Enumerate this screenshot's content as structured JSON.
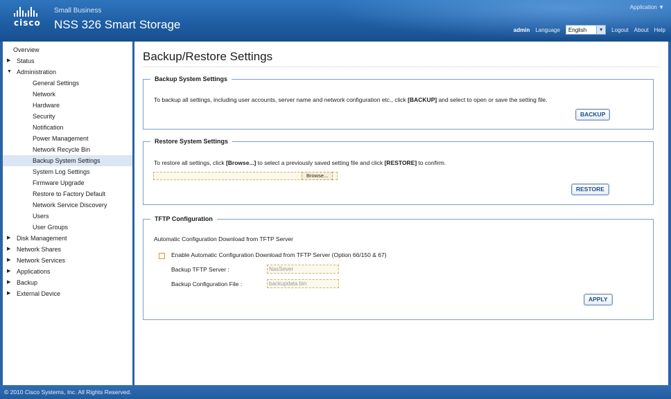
{
  "header": {
    "brand": "cisco",
    "small_business": "Small Business",
    "product": "NSS 326 Smart Storage",
    "application_menu": "Application ▼",
    "user": "admin",
    "language_label": "Language",
    "language_value": "English",
    "logout": "Logout",
    "about": "About",
    "help": "Help"
  },
  "sidebar": {
    "items": [
      {
        "label": "Overview",
        "level": "top",
        "icon": "none"
      },
      {
        "label": "Status",
        "level": "top",
        "icon": "triangle-right-icon"
      },
      {
        "label": "Administration",
        "level": "top",
        "icon": "triangle-down-icon"
      },
      {
        "label": "General Settings",
        "level": "sub",
        "icon": "none"
      },
      {
        "label": "Network",
        "level": "sub",
        "icon": "none"
      },
      {
        "label": "Hardware",
        "level": "sub",
        "icon": "none"
      },
      {
        "label": "Security",
        "level": "sub",
        "icon": "none"
      },
      {
        "label": "Notification",
        "level": "sub",
        "icon": "none"
      },
      {
        "label": "Power Management",
        "level": "sub",
        "icon": "none"
      },
      {
        "label": "Network Recycle Bin",
        "level": "sub",
        "icon": "none"
      },
      {
        "label": "Backup System Settings",
        "level": "sub",
        "icon": "none",
        "active": true
      },
      {
        "label": "System Log Settings",
        "level": "sub",
        "icon": "none"
      },
      {
        "label": "Firmware Upgrade",
        "level": "sub",
        "icon": "none"
      },
      {
        "label": "Restore to Factory Default",
        "level": "sub",
        "icon": "none"
      },
      {
        "label": "Network Service Discovery",
        "level": "sub",
        "icon": "none"
      },
      {
        "label": "Users",
        "level": "sub",
        "icon": "none"
      },
      {
        "label": "User Groups",
        "level": "sub",
        "icon": "none"
      },
      {
        "label": "Disk Management",
        "level": "top",
        "icon": "triangle-right-icon"
      },
      {
        "label": "Network Shares",
        "level": "top",
        "icon": "triangle-right-icon"
      },
      {
        "label": "Network Services",
        "level": "top",
        "icon": "triangle-right-icon"
      },
      {
        "label": "Applications",
        "level": "top",
        "icon": "triangle-right-icon"
      },
      {
        "label": "Backup",
        "level": "top",
        "icon": "triangle-right-icon"
      },
      {
        "label": "External Device",
        "level": "top",
        "icon": "triangle-right-icon"
      }
    ]
  },
  "main": {
    "title": "Backup/Restore Settings",
    "backup": {
      "legend": "Backup System Settings",
      "desc_pre": "To backup all settings, including user accounts, server name and network configuration etc., click ",
      "desc_bold": "[BACKUP]",
      "desc_post": " and select to open or save the setting file.",
      "button": "BACKUP"
    },
    "restore": {
      "legend": "Restore System Settings",
      "desc_pre": "To restore all settings, click ",
      "desc_bold1": "[Browse...]",
      "desc_mid": " to select a previously saved setting file and click ",
      "desc_bold2": "[RESTORE]",
      "desc_post": " to confirm.",
      "file_value": "",
      "browse": "Browse...",
      "button": "RESTORE"
    },
    "tftp": {
      "legend": "TFTP Configuration",
      "desc": "Automatic Configuration Download from TFTP Server",
      "checkbox_label": "Enable Automatic Configuration Download from TFTP Server (Option 66/150 & 67)",
      "checkbox_checked": false,
      "server_label": "Backup TFTP Server :",
      "server_value": "NasSever",
      "file_label": "Backup Configuration File :",
      "file_value": "backupdata.bin",
      "button": "APPLY"
    }
  },
  "footer": {
    "copyright": "© 2010 Cisco Systems, Inc. All Rights Reserved."
  }
}
